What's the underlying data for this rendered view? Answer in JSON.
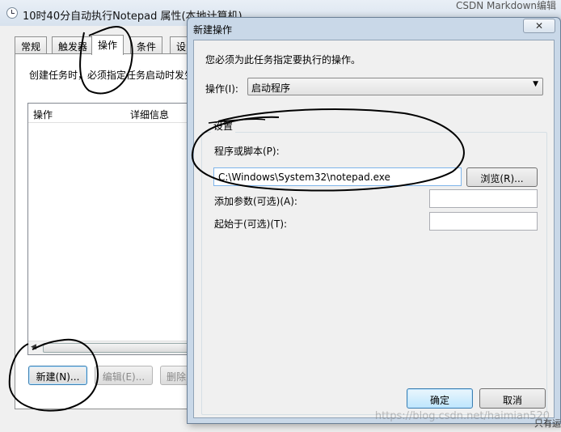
{
  "background_window": {
    "title": "10时40分自动执行Notepad 属性(本地计算机)",
    "top_right_text": "CSDN Markdown编辑",
    "tabs": [
      {
        "label": "常规"
      },
      {
        "label": "触发器"
      },
      {
        "label": "操作"
      },
      {
        "label": "条件"
      },
      {
        "label": "设"
      }
    ],
    "hint": "创建任务时，必须指定任务启动时发生",
    "list_columns": {
      "action": "操作",
      "details": "详细信息"
    },
    "buttons": {
      "new": "新建(N)...",
      "edit": "编辑(E)...",
      "delete": "删除"
    }
  },
  "dialog": {
    "title": "新建操作",
    "close_glyph": "✕",
    "instruction": "您必须为此任务指定要执行的操作。",
    "action_label": "操作(I):",
    "action_value": "启动程序",
    "settings_title": "设置",
    "program_label": "程序或脚本(P):",
    "program_value": "C:\\Windows\\System32\\notepad.exe",
    "browse_label": "浏览(R)...",
    "args_label": "添加参数(可选)(A):",
    "args_value": "",
    "start_in_label": "起始于(可选)(T):",
    "start_in_value": "",
    "ok_label": "确定",
    "cancel_label": "取消"
  },
  "watermark": "https://blog.csdn.net/haimian520",
  "side_text": "只有运",
  "colors": {
    "dialog_frame": "#c9d8e8",
    "face": "#f0f0f0",
    "default_button_border": "#3c7fb1",
    "annotation_ink": "#000000"
  },
  "icons": {
    "title_icon": "clock-icon",
    "combo_arrow": "chevron-down-icon",
    "scroll_arrow": "chevron-left-icon"
  }
}
